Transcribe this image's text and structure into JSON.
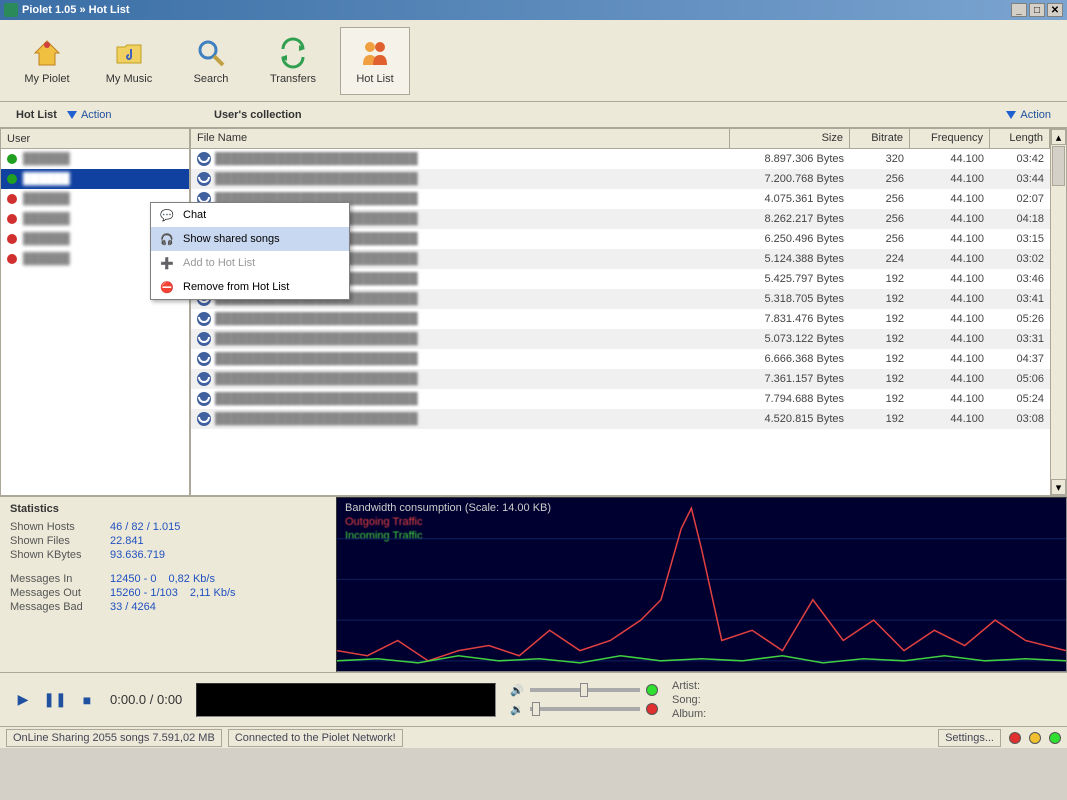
{
  "window": {
    "title": "Piolet 1.05 » Hot List"
  },
  "toolbar": {
    "items": [
      {
        "label": "My Piolet"
      },
      {
        "label": "My Music"
      },
      {
        "label": "Search"
      },
      {
        "label": "Transfers"
      },
      {
        "label": "Hot List"
      }
    ]
  },
  "leftpanel": {
    "title": "Hot List",
    "action": "Action",
    "col": "User",
    "users": [
      {
        "status": "green"
      },
      {
        "status": "green",
        "selected": true
      },
      {
        "status": "red"
      },
      {
        "status": "red"
      },
      {
        "status": "red"
      },
      {
        "status": "red"
      }
    ]
  },
  "rightpanel": {
    "title": "User's collection",
    "action": "Action",
    "columns": {
      "file": "File Name",
      "size": "Size",
      "bitrate": "Bitrate",
      "freq": "Frequency",
      "len": "Length"
    },
    "rows": [
      {
        "size": "8.897.306 Bytes",
        "bitrate": "320",
        "freq": "44.100",
        "len": "03:42"
      },
      {
        "size": "7.200.768 Bytes",
        "bitrate": "256",
        "freq": "44.100",
        "len": "03:44"
      },
      {
        "size": "4.075.361 Bytes",
        "bitrate": "256",
        "freq": "44.100",
        "len": "02:07"
      },
      {
        "size": "8.262.217 Bytes",
        "bitrate": "256",
        "freq": "44.100",
        "len": "04:18"
      },
      {
        "size": "6.250.496 Bytes",
        "bitrate": "256",
        "freq": "44.100",
        "len": "03:15"
      },
      {
        "size": "5.124.388 Bytes",
        "bitrate": "224",
        "freq": "44.100",
        "len": "03:02"
      },
      {
        "size": "5.425.797 Bytes",
        "bitrate": "192",
        "freq": "44.100",
        "len": "03:46"
      },
      {
        "size": "5.318.705 Bytes",
        "bitrate": "192",
        "freq": "44.100",
        "len": "03:41"
      },
      {
        "size": "7.831.476 Bytes",
        "bitrate": "192",
        "freq": "44.100",
        "len": "05:26"
      },
      {
        "size": "5.073.122 Bytes",
        "bitrate": "192",
        "freq": "44.100",
        "len": "03:31"
      },
      {
        "size": "6.666.368 Bytes",
        "bitrate": "192",
        "freq": "44.100",
        "len": "04:37"
      },
      {
        "size": "7.361.157 Bytes",
        "bitrate": "192",
        "freq": "44.100",
        "len": "05:06"
      },
      {
        "size": "7.794.688 Bytes",
        "bitrate": "192",
        "freq": "44.100",
        "len": "05:24"
      },
      {
        "size": "4.520.815 Bytes",
        "bitrate": "192",
        "freq": "44.100",
        "len": "03:08"
      }
    ]
  },
  "context_menu": {
    "chat": "Chat",
    "show": "Show shared songs",
    "add": "Add to Hot List",
    "remove": "Remove from Hot List"
  },
  "stats": {
    "title": "Statistics",
    "shown_hosts_l": "Shown Hosts",
    "shown_hosts_v": "46 / 82 / 1.015",
    "shown_files_l": "Shown Files",
    "shown_files_v": "22.841",
    "shown_kb_l": "Shown KBytes",
    "shown_kb_v": "93.636.719",
    "msg_in_l": "Messages In",
    "msg_in_v": "12450 - 0",
    "msg_in_r": "0,82 Kb/s",
    "msg_out_l": "Messages Out",
    "msg_out_v": "15260 - 1/103",
    "msg_out_r": "2,11 Kb/s",
    "msg_bad_l": "Messages Bad",
    "msg_bad_v": "33 / 4264"
  },
  "bandwidth": {
    "title": "Bandwidth consumption  (Scale: 14.00 KB)",
    "out": "Outgoing Traffic",
    "in": "Incoming Traffic"
  },
  "player": {
    "time": "0:00.0 / 0:00",
    "artist_l": "Artist:",
    "song_l": "Song:",
    "album_l": "Album:"
  },
  "status": {
    "sharing": "OnLine Sharing 2055 songs 7.591,02 MB",
    "conn": "Connected to the Piolet Network!",
    "settings": "Settings..."
  }
}
